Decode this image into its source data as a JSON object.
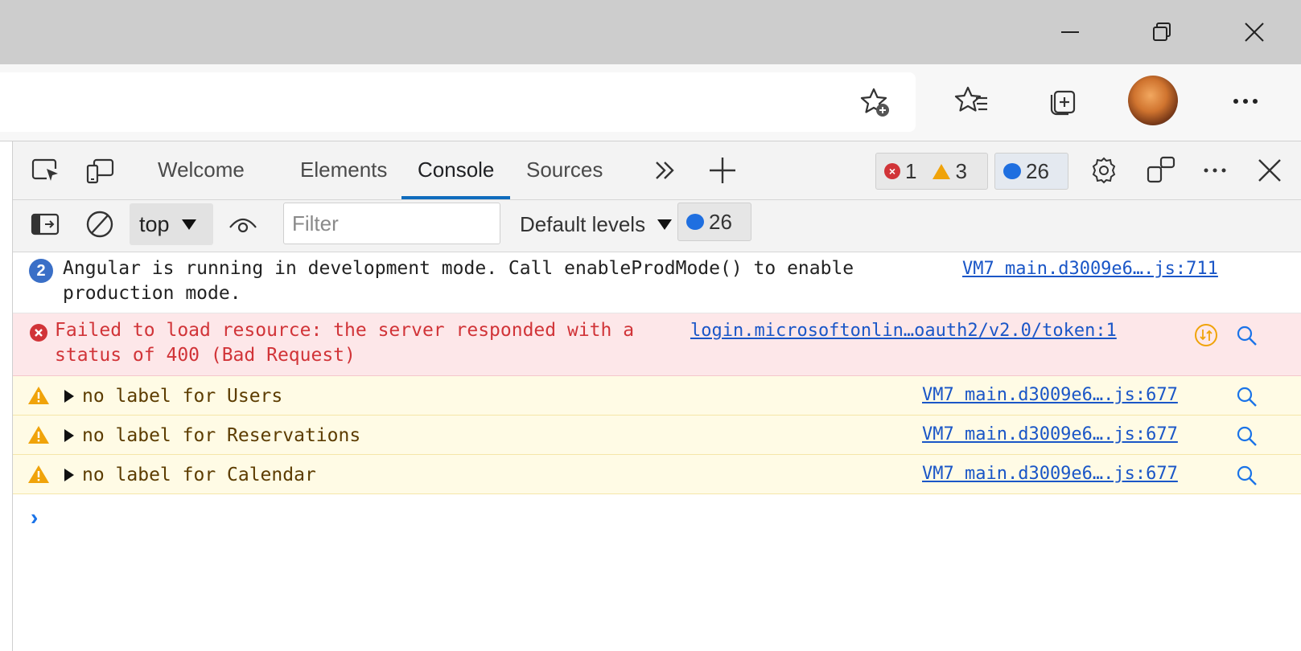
{
  "window": {
    "minimize_icon": "minimize-icon",
    "restore_icon": "restore-icon",
    "close_icon": "close-icon"
  },
  "toolbar": {
    "icons": [
      "add-favorite-icon",
      "favorites-icon",
      "collections-icon",
      "profile-avatar",
      "more-icon"
    ]
  },
  "devtools": {
    "tabs": [
      {
        "label": "Welcome"
      },
      {
        "label": "Elements"
      },
      {
        "label": "Console"
      },
      {
        "label": "Sources"
      }
    ],
    "active_tab": "Console",
    "error_count": "1",
    "warning_count": "3",
    "info_count": "26"
  },
  "console_toolbar": {
    "context": "top",
    "filter_placeholder": "Filter",
    "levels": "Default levels",
    "issues_count": "26"
  },
  "messages": [
    {
      "level": "info",
      "repeat": "2",
      "text": "Angular is running in development mode. Call enableProdMode() to enable\nproduction mode.",
      "source": "VM7 main.d3009e6….js:711"
    },
    {
      "level": "error",
      "text": "Failed to load resource: the server responded with a\nstatus of 400 (Bad Request)",
      "source": "login.microsoftonlin…oauth2/v2.0/token:1"
    },
    {
      "level": "warning",
      "text": "no label for Users",
      "source": "VM7 main.d3009e6….js:677"
    },
    {
      "level": "warning",
      "text": "no label for Reservations",
      "source": "VM7 main.d3009e6….js:677"
    },
    {
      "level": "warning",
      "text": "no label for Calendar",
      "source": "VM7 main.d3009e6….js:677"
    }
  ],
  "colors": {
    "accent": "#0f6cbd",
    "error": "#d13438",
    "warning": "#f0a30a",
    "info": "#1f6fe0"
  }
}
